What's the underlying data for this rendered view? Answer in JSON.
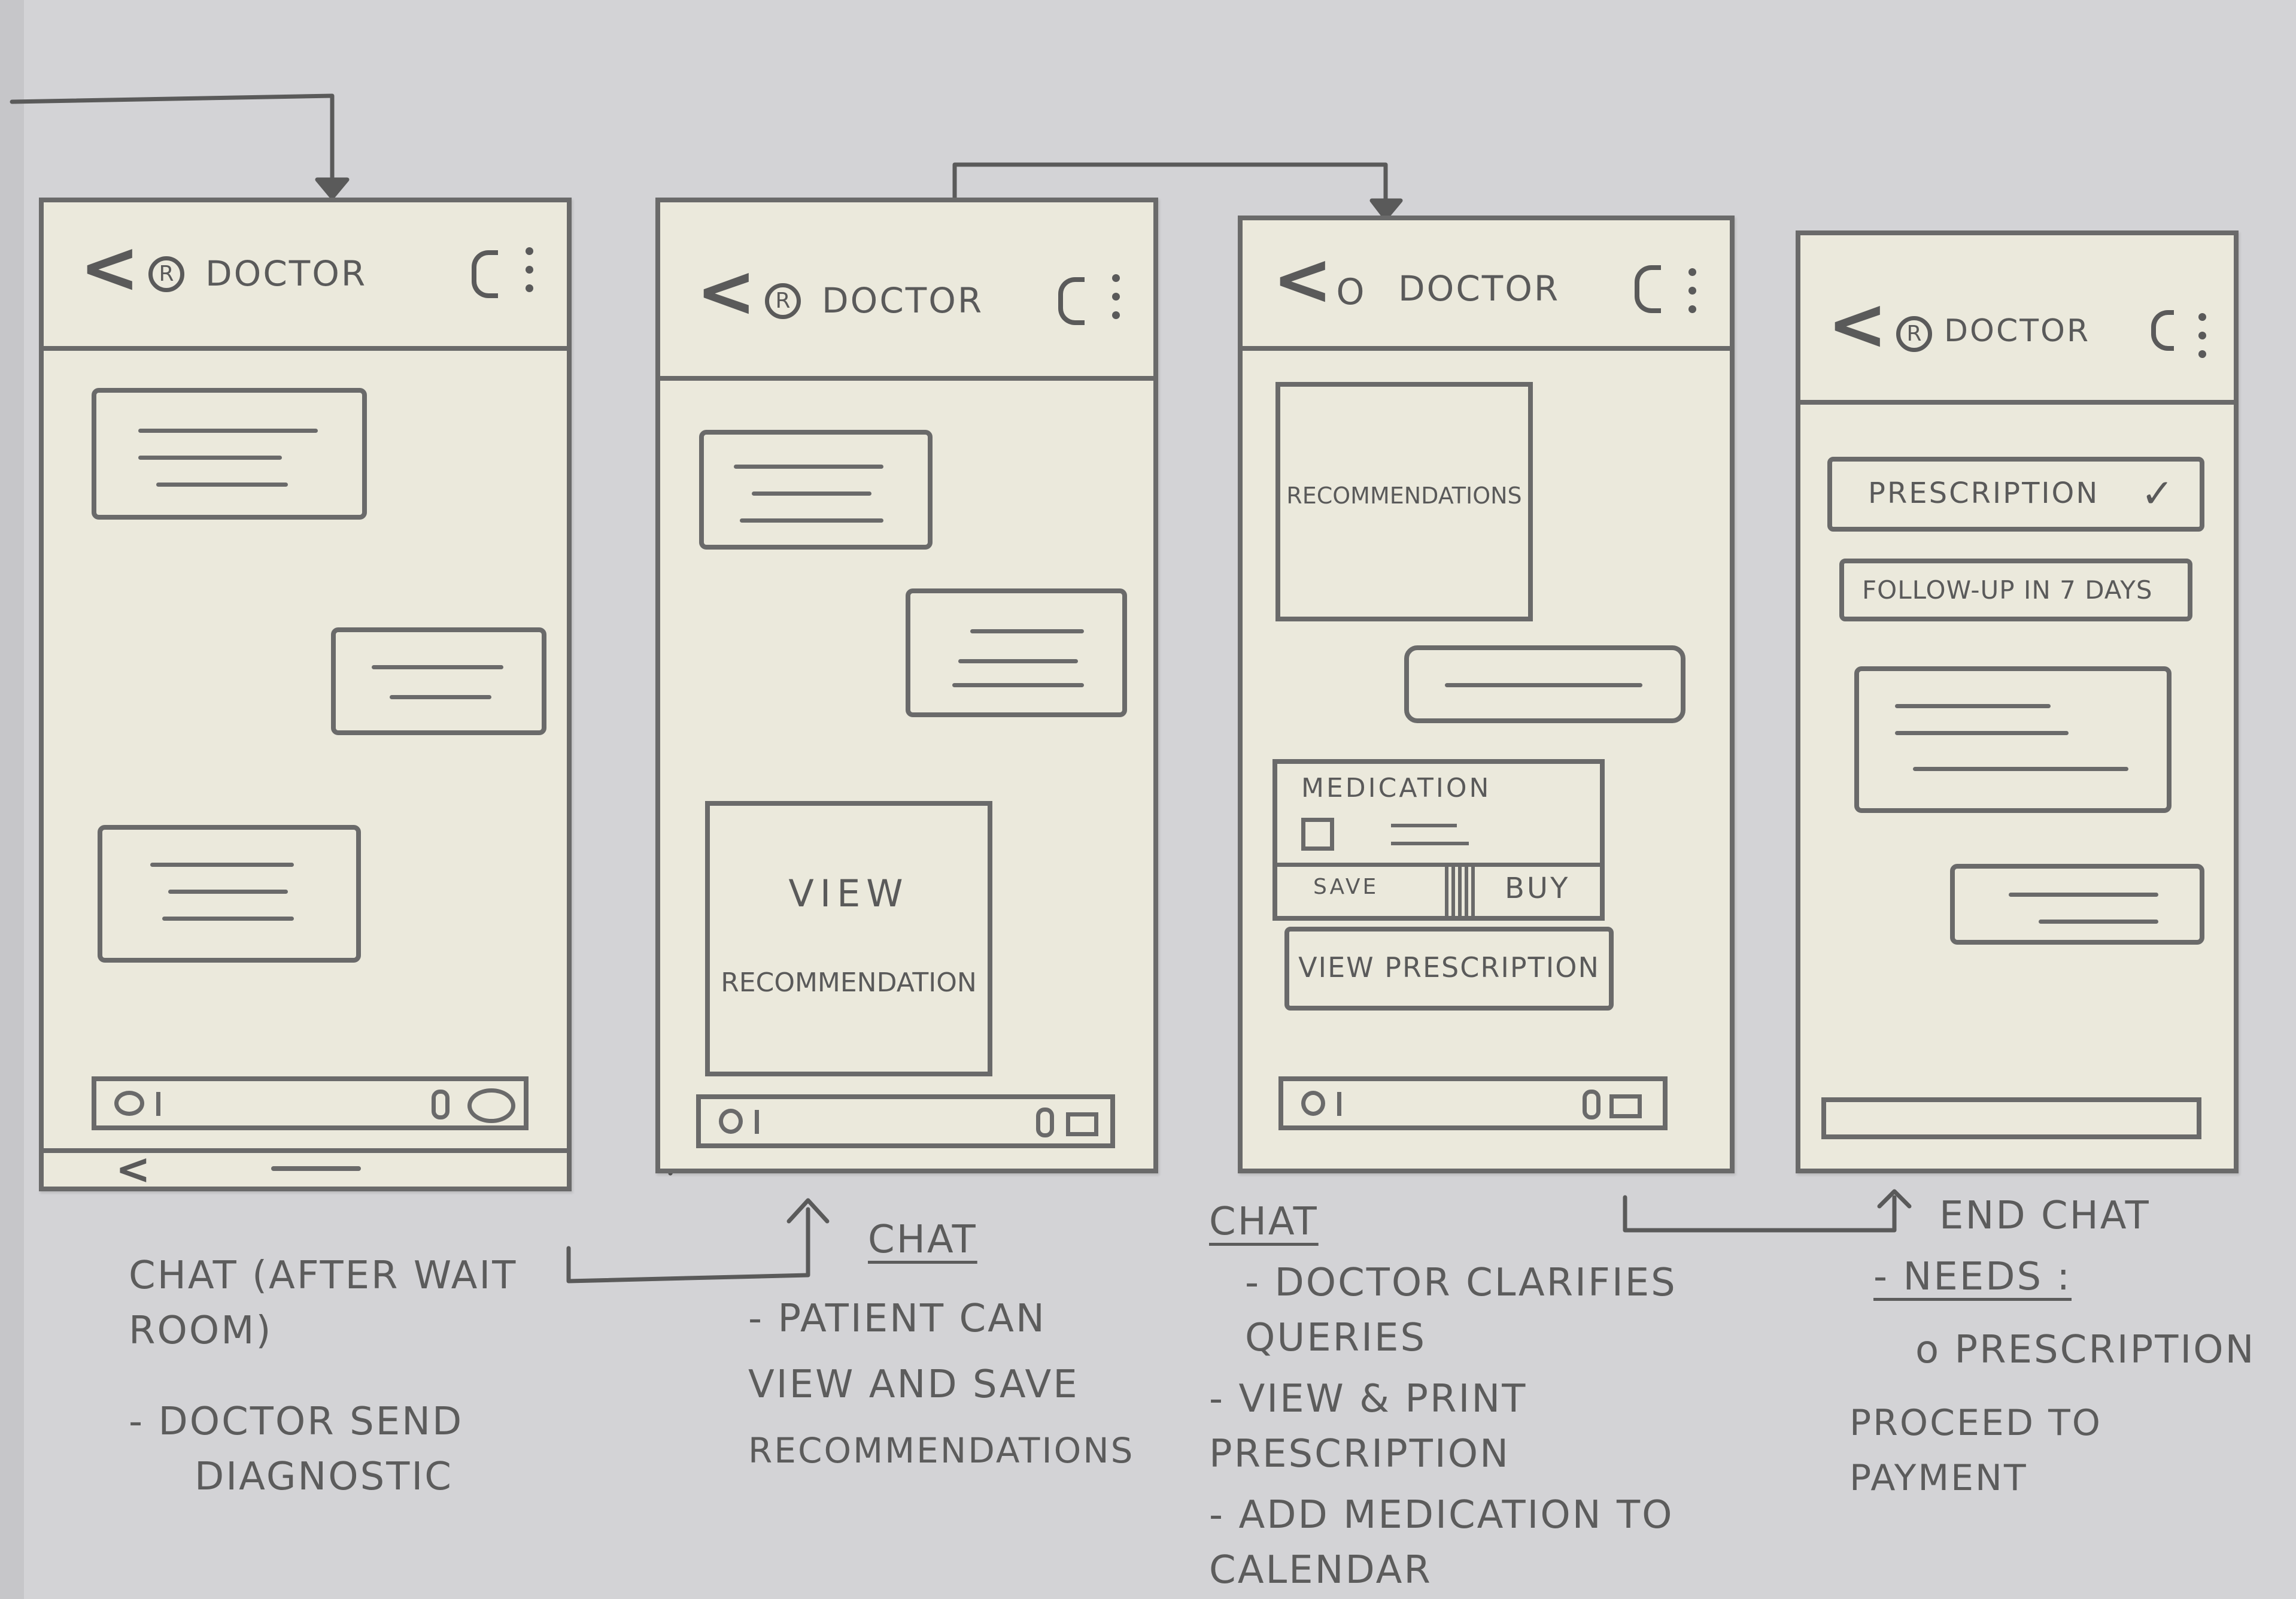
{
  "screens": [
    {
      "title": "DOCTOR",
      "avatar_glyph": "R",
      "caption_title": "CHAT (AFTER WAIT ROOM)",
      "caption_lines": [
        "- DOCTOR SEND",
        "DIAGNOSTIC"
      ]
    },
    {
      "title": "DOCTOR",
      "avatar_glyph": "R",
      "card_text_1": "VIEW",
      "card_text_2": "RECOMMENDATION",
      "caption_title": "CHAT",
      "caption_lines": [
        "- PATIENT CAN",
        "VIEW AND SAVE",
        "RECOMMENDATIONS"
      ]
    },
    {
      "title": "DOCTOR",
      "avatar_glyph": "O",
      "card_text": "RECOMMENDATIONS",
      "medication_title": "MEDICATION",
      "save_label": "SAVE",
      "buy_label": "BUY",
      "view_prescription_label": "VIEW PRESCRIPTION",
      "caption_title": "CHAT",
      "caption_lines": [
        "- DOCTOR CLARIFIES",
        "QUERIES",
        "- VIEW & PRINT",
        "PRESCRIPTION",
        "- ADD MEDICATION TO",
        "CALENDAR"
      ]
    },
    {
      "title": "DOCTOR",
      "avatar_glyph": "R",
      "prescription_label": "PRESCRIPTION",
      "check_glyph": "✓",
      "followup_label": "FOLLOW-UP IN 7 DAYS",
      "caption_title": "END CHAT",
      "caption_lines": [
        "- NEEDS :",
        "o PRESCRIPTION",
        "PROCEED TO PAYMENT"
      ]
    }
  ]
}
